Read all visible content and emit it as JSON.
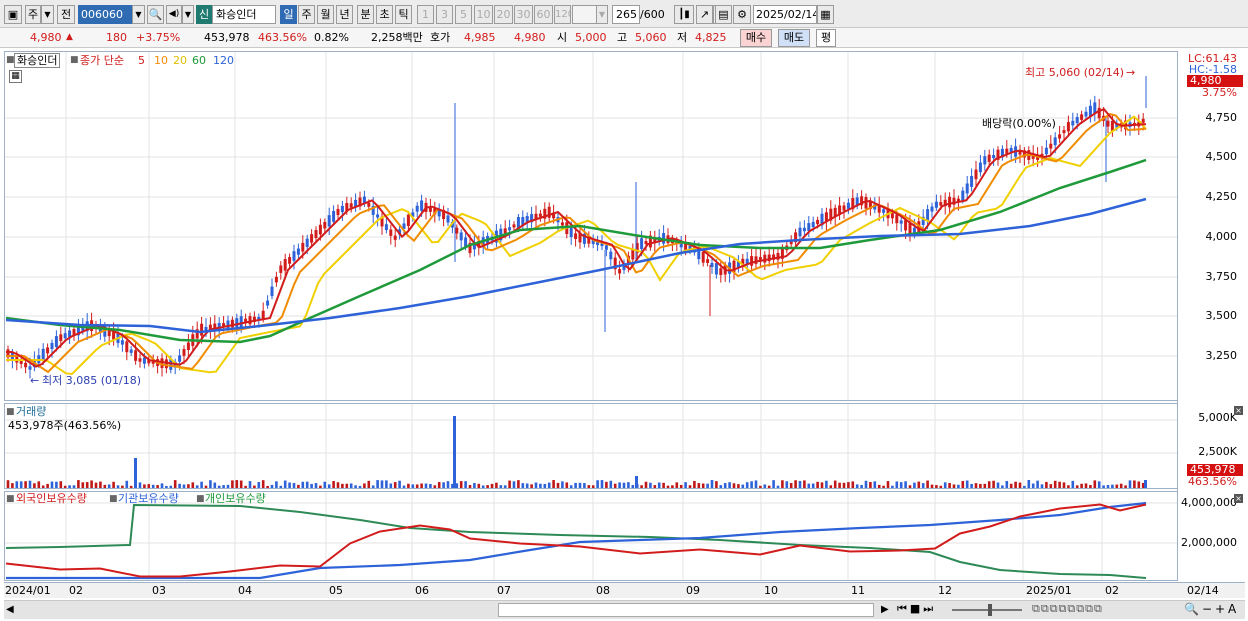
{
  "toolbar": {
    "period_label": "주",
    "prev_label": "전",
    "code_value": "006060",
    "new_badge": "신",
    "stock_name": "화승인더",
    "period_tabs": [
      "일",
      "주",
      "월",
      "년",
      "분",
      "초",
      "틱"
    ],
    "interval_buttons": [
      "1",
      "3",
      "5",
      "10",
      "20",
      "30",
      "60",
      "120"
    ],
    "count_value": "265",
    "count_total": "/600",
    "date_value": "2025/02/14"
  },
  "quote": {
    "price": "4,980",
    "change": "180",
    "change_pct": "+3.75%",
    "volume": "453,978",
    "volume_pct": "463.56%",
    "turnover": "0.82%",
    "amount": "2,258백만",
    "bid_label": "호가",
    "bid1": "4,985",
    "bid2": "4,980",
    "open_label": "시",
    "open": "5,000",
    "high_label": "고",
    "high": "5,060",
    "low_label": "저",
    "low": "4,825",
    "buy_label": "매수",
    "sell_label": "매도",
    "avg_label": "평"
  },
  "price_panel": {
    "name_tag": "화승인더",
    "ma_label": "종가 단순",
    "ma_periods": [
      "5",
      "10",
      "20",
      "60",
      "120"
    ],
    "ma_colors": [
      "#d21c1c",
      "#f08c00",
      "#f0d000",
      "#1f9a3a",
      "#2d62d8"
    ],
    "high_note": "최고 5,060 (02/14)",
    "low_note": "최저 3,085 (01/18)",
    "dividend_note": "배당락(0.00%)",
    "lc_label": "LC:61.43",
    "hc_label": "HC:-1.58",
    "last_tag": "4,980",
    "pct_tag": "3.75%",
    "y_ticks": [
      "4,750",
      "4,500",
      "4,250",
      "4,000",
      "3,750",
      "3,500",
      "3,250"
    ]
  },
  "volume_panel": {
    "title": "거래량",
    "value_label": "453,978주(463.56%)",
    "y_ticks": [
      "5,000K",
      "2,500K"
    ],
    "last_tag": "453,978",
    "pct_tag": "463.56%"
  },
  "holding_panel": {
    "legend": [
      "외국인보유수량",
      "기관보유수량",
      "개인보유수량"
    ],
    "legend_colors": [
      "#d21c1c",
      "#2d62d8",
      "#1f9a3a"
    ],
    "y_ticks": [
      "4,000,000",
      "2,000,000"
    ]
  },
  "x_axis": {
    "labels": [
      "2024/01",
      "02",
      "03",
      "04",
      "05",
      "06",
      "07",
      "08",
      "09",
      "10",
      "11",
      "12",
      "2025/01",
      "02"
    ],
    "end_label": "02/14"
  }
}
